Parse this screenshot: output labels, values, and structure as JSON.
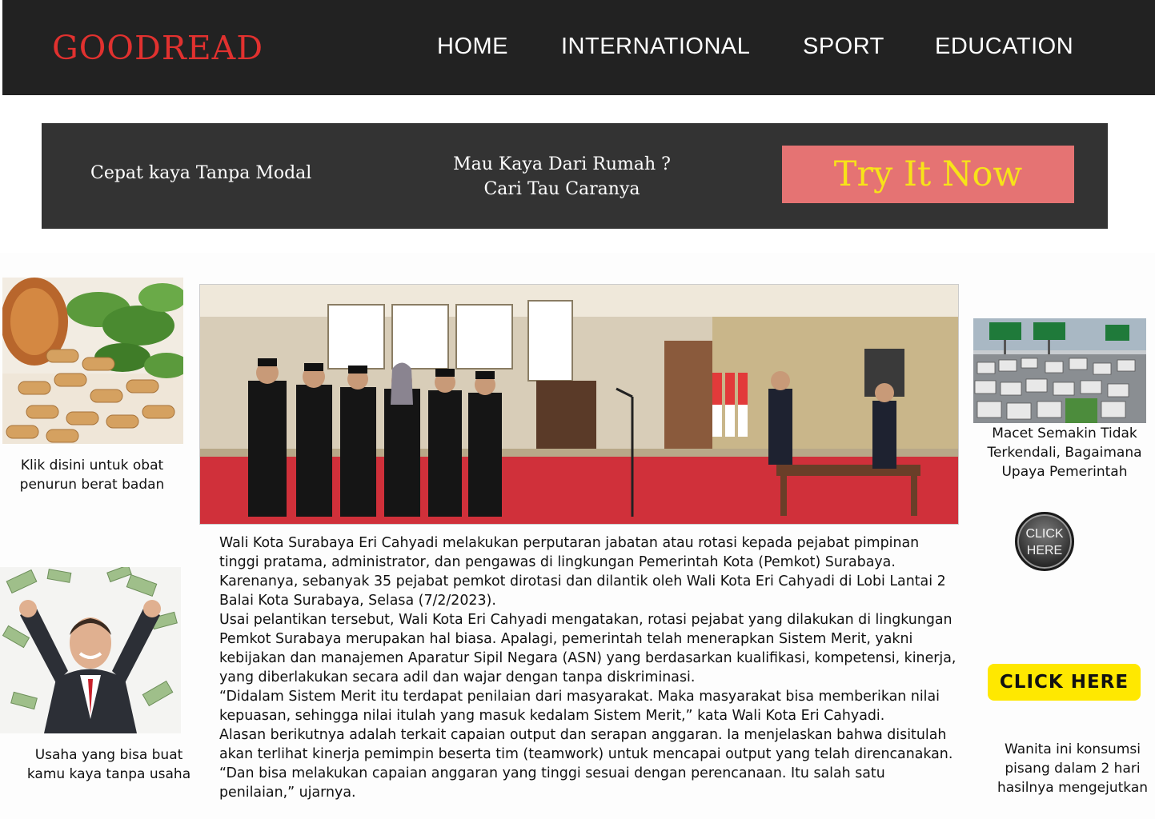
{
  "header": {
    "logo": "GOODREAD",
    "nav": [
      "HOME",
      "INTERNATIONAL",
      "SPORT",
      "EDUCATION"
    ]
  },
  "banner": {
    "left_text": "Cepat kaya Tanpa Modal",
    "mid_line1": "Mau Kaya Dari Rumah ?",
    "mid_line2": "Cari Tau Caranya",
    "cta": "Try It Now"
  },
  "left_ads": [
    {
      "caption": "Klik disini untuk obat penurun berat badan",
      "image": "herbal-capsules-image"
    },
    {
      "caption": "Usaha yang bisa buat kamu kaya tanpa usaha",
      "image": "rich-businessman-image"
    }
  ],
  "main": {
    "image": "inauguration-ceremony-photo",
    "paragraphs": [
      "Wali Kota Surabaya Eri Cahyadi melakukan perputaran jabatan atau rotasi kepada pejabat pimpinan tinggi pratama, administrator, dan pengawas di lingkungan Pemerintah Kota (Pemkot) Surabaya. Karenanya, sebanyak 35 pejabat pemkot dirotasi dan dilantik oleh Wali Kota Eri Cahyadi di Lobi Lantai 2 Balai Kota Surabaya, Selasa (7/2/2023).",
      "Usai pelantikan tersebut, Wali Kota Eri Cahyadi mengatakan, rotasi pejabat yang dilakukan di lingkungan Pemkot Surabaya merupakan hal biasa. Apalagi, pemerintah telah menerapkan Sistem Merit, yakni kebijakan dan manajemen Aparatur Sipil Negara (ASN) yang berdasarkan kualifikasi, kompetensi, kinerja, yang diberlakukan secara adil dan wajar dengan tanpa diskriminasi.",
      "“Didalam Sistem Merit itu terdapat penilaian dari masyarakat. Maka masyarakat bisa memberikan nilai kepuasan, sehingga nilai itulah yang masuk kedalam Sistem Merit,” kata Wali Kota Eri Cahyadi.",
      "Alasan berikutnya adalah terkait capaian output dan serapan anggaran. Ia menjelaskan bahwa disitulah akan terlihat kinerja pemimpin beserta tim (teamwork) untuk mencapai output yang telah direncanakan. “Dan bisa melakukan capaian anggaran yang tinggi sesuai dengan perencanaan. Itu salah satu penilaian,” ujarnya."
    ]
  },
  "right_ads": {
    "traffic_caption": "Macet Semakin Tidak Terkendali, Bagaimana Upaya Pemerintah",
    "circle_button_line1": "CLICK",
    "circle_button_line2": "HERE",
    "bar_button": "CLICK HERE",
    "bottom_caption": "Wanita ini konsumsi pisang dalam 2 hari hasilnya mengejutkan"
  },
  "colors": {
    "header_bg": "#222222",
    "logo": "#e1312f",
    "banner_bg": "#333333",
    "cta_bg": "#e57373",
    "cta_text": "#f7e319",
    "click_bar": "#ffe800"
  }
}
